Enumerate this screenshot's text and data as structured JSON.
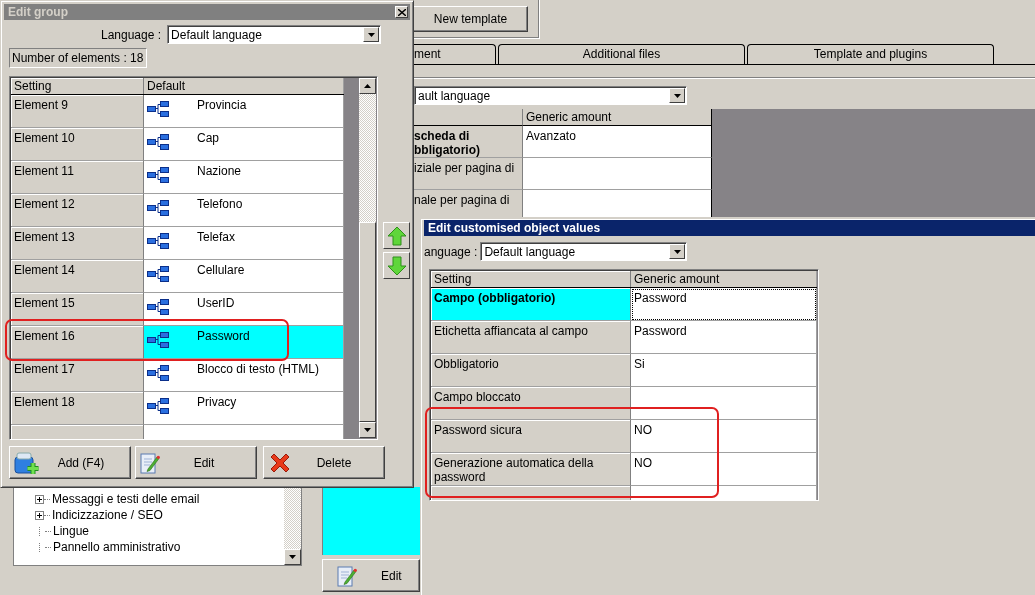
{
  "background_window": {
    "new_template_button": "New template",
    "tabs": [
      {
        "label": "ment"
      },
      {
        "label": "Additional files"
      },
      {
        "label": "Template and plugins"
      }
    ],
    "language_value": "ault language",
    "grid": {
      "value_column": "Generic amount",
      "rows": [
        {
          "setting": "scheda di\nbbligatorio)",
          "value": "Avanzato",
          "emphasized": true
        },
        {
          "setting": "iziale per pagina di",
          "value": "",
          "emphasized": false
        },
        {
          "setting": "nale per pagina di",
          "value": "",
          "emphasized": false
        }
      ]
    },
    "tree": [
      {
        "label": "Messaggi e testi delle email",
        "expandable": true
      },
      {
        "label": "Indicizzazione / SEO",
        "expandable": true
      },
      {
        "label": "Lingue",
        "expandable": false
      },
      {
        "label": "Pannello amministrativo",
        "expandable": false
      }
    ],
    "edit_button": "Edit"
  },
  "edit_group": {
    "title": "Edit group",
    "active": false,
    "language_label": "Language :",
    "language_value": "Default language",
    "count": "Number of elements : 18",
    "columns": [
      "Setting",
      "Default"
    ],
    "rows": [
      {
        "setting": "Element 9",
        "value": "Provincia",
        "selected": false
      },
      {
        "setting": "Element 10",
        "value": "Cap",
        "selected": false
      },
      {
        "setting": "Element 11",
        "value": "Nazione",
        "selected": false
      },
      {
        "setting": "Element 12",
        "value": "Telefono",
        "selected": false
      },
      {
        "setting": "Element 13",
        "value": "Telefax",
        "selected": false
      },
      {
        "setting": "Element 14",
        "value": "Cellulare",
        "selected": false
      },
      {
        "setting": "Element 15",
        "value": "UserID",
        "selected": false
      },
      {
        "setting": "Element 16",
        "value": "Password",
        "selected": true
      },
      {
        "setting": "Element 17",
        "value": "Blocco di testo (HTML)",
        "selected": false
      },
      {
        "setting": "Element 18",
        "value": "Privacy",
        "selected": false
      }
    ],
    "buttons": [
      {
        "kind": "add",
        "label": "Add (F4)"
      },
      {
        "kind": "edit",
        "label": "Edit"
      },
      {
        "kind": "delete",
        "label": "Delete"
      }
    ]
  },
  "edit_values": {
    "title": "Edit customised object values",
    "active": true,
    "language_label": "anguage :",
    "language_value": "Default language",
    "columns": [
      "Setting",
      "Generic amount"
    ],
    "rows": [
      {
        "setting": "Campo (obbligatorio)",
        "value": "Password",
        "selected": true
      },
      {
        "setting": "Etichetta affiancata al campo",
        "value": "Password",
        "selected": false
      },
      {
        "setting": "Obbligatorio",
        "value": "Si",
        "selected": false
      },
      {
        "setting": "Campo bloccato",
        "value": "",
        "selected": false
      },
      {
        "setting": "Password sicura",
        "value": "NO",
        "selected": false
      },
      {
        "setting": "Generazione automatica della password",
        "value": "NO",
        "selected": false
      }
    ]
  }
}
